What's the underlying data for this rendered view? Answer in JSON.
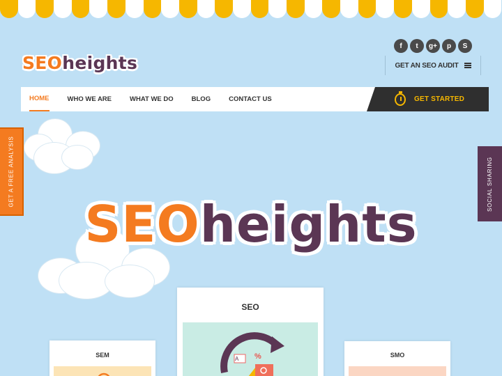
{
  "logo": {
    "seo": "SEO",
    "heights": "heights"
  },
  "social_icons": [
    {
      "name": "facebook-icon",
      "glyph": "f"
    },
    {
      "name": "twitter-icon",
      "glyph": "t"
    },
    {
      "name": "google-plus-icon",
      "glyph": "g+"
    },
    {
      "name": "pinterest-icon",
      "glyph": "p"
    },
    {
      "name": "skype-icon",
      "glyph": "S"
    }
  ],
  "audit": {
    "label": "GET AN SEO AUDIT",
    "icon": "menu-icon"
  },
  "nav": {
    "items": [
      "HOME",
      "WHO WE ARE",
      "WHAT WE DO",
      "BLOG",
      "CONTACT US"
    ],
    "active": "HOME"
  },
  "cta": {
    "label": "GET STARTED",
    "icon": "stopwatch-icon"
  },
  "side_tabs": {
    "left": "GET A FREE ANALYSIS",
    "right": "SOCIAL SHARING"
  },
  "hero": {
    "seo": "SEO",
    "heights": "heights"
  },
  "cards": {
    "seo": "SEO",
    "sem": "SEM",
    "smo": "SMO"
  },
  "colors": {
    "sky": "#bfe0f5",
    "orange": "#f47b20",
    "purple": "#5b3654",
    "awning_yellow": "#f6b700",
    "dark": "#2f2f2f"
  }
}
